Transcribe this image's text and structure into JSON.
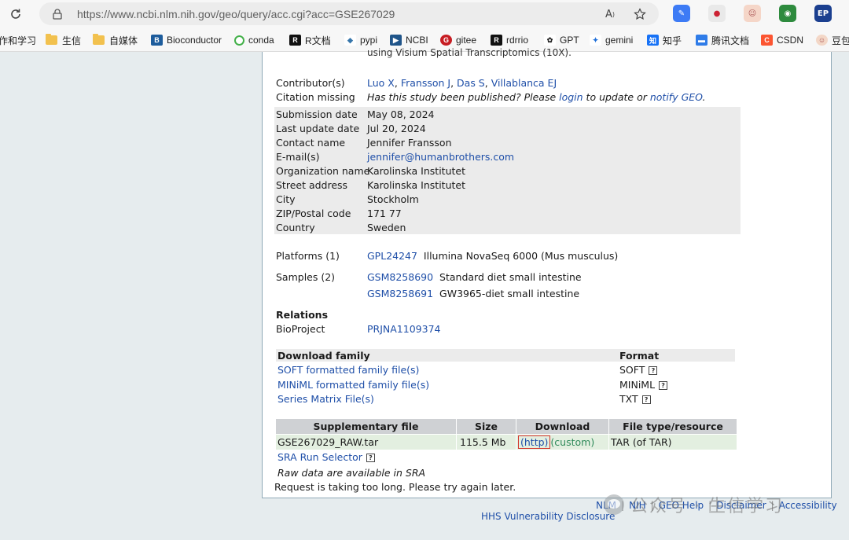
{
  "browser": {
    "url": "https://www.ncbi.nlm.nih.gov/geo/query/acc.cgi?acc=GSE267029",
    "bookmarks": [
      {
        "label": "作和学习",
        "icon": "folder-icon"
      },
      {
        "label": "生信",
        "icon": "folder-icon"
      },
      {
        "label": "自媒体",
        "icon": "folder-icon"
      },
      {
        "label": "Bioconductor",
        "icon": "bioconductor-icon"
      },
      {
        "label": "conda",
        "icon": "conda-icon"
      },
      {
        "label": "R文档",
        "icon": "r-icon"
      },
      {
        "label": "pypi",
        "icon": "pypi-icon"
      },
      {
        "label": "NCBI",
        "icon": "ncbi-icon"
      },
      {
        "label": "gitee",
        "icon": "gitee-icon"
      },
      {
        "label": "rdrrio",
        "icon": "r-icon"
      },
      {
        "label": "GPT",
        "icon": "openai-icon"
      },
      {
        "label": "gemini",
        "icon": "gemini-icon"
      },
      {
        "label": "知乎",
        "icon": "zhihu-icon"
      },
      {
        "label": "腾讯文档",
        "icon": "tencent-docs-icon"
      },
      {
        "label": "CSDN",
        "icon": "csdn-icon"
      },
      {
        "label": "豆包",
        "icon": "doubao-icon"
      }
    ]
  },
  "series": {
    "summary_fragment": "using Visium Spatial Transcriptomics (10X).",
    "contributors_label": "Contributor(s)",
    "contributors": [
      "Luo X",
      "Fransson J",
      "Das S",
      "Villablanca EJ"
    ],
    "citation_label": "Citation missing",
    "citation_text_1": "Has this study been published? Please ",
    "citation_login": "login",
    "citation_text_2": " to update or ",
    "citation_notify": "notify GEO",
    "citation_text_3": ".",
    "fields": [
      {
        "label": "Submission date",
        "value": "May 08, 2024"
      },
      {
        "label": "Last update date",
        "value": "Jul 20, 2024"
      },
      {
        "label": "Contact name",
        "value": "Jennifer Fransson"
      },
      {
        "label": "E-mail(s)",
        "value": "jennifer@humanbrothers.com"
      },
      {
        "label": "Organization name",
        "value": "Karolinska Institutet"
      },
      {
        "label": "Street address",
        "value": "Karolinska Institutet"
      },
      {
        "label": "City",
        "value": "Stockholm"
      },
      {
        "label": "ZIP/Postal code",
        "value": "171 77"
      },
      {
        "label": "Country",
        "value": "Sweden"
      }
    ],
    "platforms_label": "Platforms (1)",
    "platform_id": "GPL24247",
    "platform_desc": "Illumina NovaSeq 6000 (Mus musculus)",
    "samples_label": "Samples (2)",
    "samples": [
      {
        "id": "GSM8258690",
        "desc": "Standard diet small intestine"
      },
      {
        "id": "GSM8258691",
        "desc": "GW3965-diet small intestine"
      }
    ],
    "relations_label": "Relations",
    "bioproject_label": "BioProject",
    "bioproject_id": "PRJNA1109374"
  },
  "download_family": {
    "header": "Download family",
    "format_header": "Format",
    "rows": [
      {
        "label": "SOFT formatted family file(s)",
        "format": "SOFT"
      },
      {
        "label": "MINiML formatted family file(s)",
        "format": "MINiML"
      },
      {
        "label": "Series Matrix File(s)",
        "format": "TXT"
      }
    ]
  },
  "supplementary": {
    "headers": [
      "Supplementary file",
      "Size",
      "Download",
      "File type/resource"
    ],
    "file": "GSE267029_RAW.tar",
    "size": "115.5 Mb",
    "http": "(http)",
    "custom": "(custom)",
    "type": "TAR (of TAR)",
    "sra_selector": "SRA Run Selector",
    "raw_note": "Raw data are available in SRA",
    "timeout": "Request is taking too long. Please try again later."
  },
  "footer": {
    "links": [
      "NLM",
      "NIH",
      "GEO Help",
      "Disclaimer",
      "Accessibility"
    ],
    "hhs": "HHS Vulnerability Disclosure"
  },
  "watermark": "公众号 · 生信学习"
}
